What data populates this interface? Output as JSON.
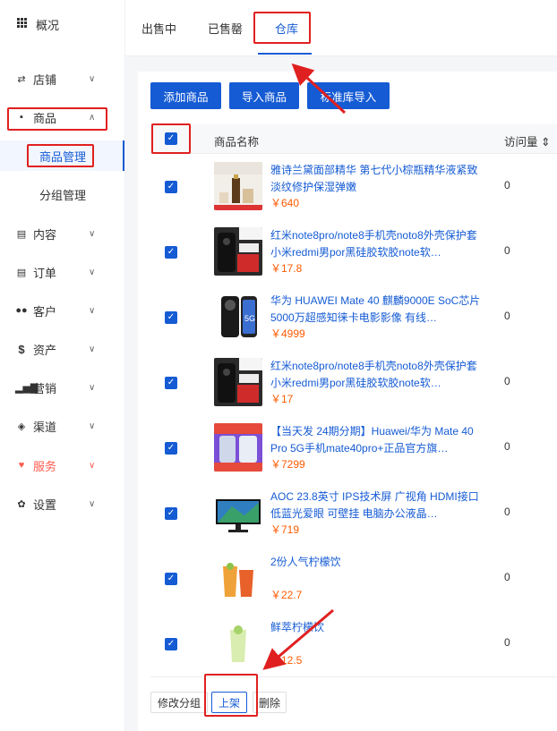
{
  "sidebar": {
    "items": [
      {
        "label": "概况",
        "icon": "grid-icon"
      },
      {
        "label": "店铺",
        "icon": "store-icon"
      },
      {
        "label": "商品",
        "icon": "goods-icon"
      },
      {
        "label": "商品管理"
      },
      {
        "label": "分组管理"
      },
      {
        "label": "内容",
        "icon": "content-icon"
      },
      {
        "label": "订单",
        "icon": "order-icon"
      },
      {
        "label": "客户",
        "icon": "customer-icon"
      },
      {
        "label": "资产",
        "icon": "asset-icon"
      },
      {
        "label": "营销",
        "icon": "marketing-icon"
      },
      {
        "label": "渠道",
        "icon": "channel-icon"
      },
      {
        "label": "服务",
        "icon": "heart-icon"
      },
      {
        "label": "设置",
        "icon": "gear-icon"
      }
    ]
  },
  "tabs": [
    {
      "label": "出售中"
    },
    {
      "label": "已售罄"
    },
    {
      "label": "仓库",
      "active": true
    }
  ],
  "toolbar": {
    "add_label": "添加商品",
    "import_label": "导入商品",
    "std_import_label": "标准库导入"
  },
  "table": {
    "col_name": "商品名称",
    "col_visits": "访问量 ⇕",
    "rows": [
      {
        "title": "雅诗兰黛面部精华 第七代小棕瓶精华液紧致淡纹修护保湿弹嫩",
        "price": "￥640",
        "visits": "0"
      },
      {
        "title": "红米note8pro/note8手机壳noto8外壳保护套小米redmi男por黑硅胶软胶note软…",
        "price": "￥17.8",
        "visits": "0"
      },
      {
        "title": "华为 HUAWEI Mate 40 麒麟9000E SoC芯片 5000万超感知徕卡电影影像 有线…",
        "price": "￥4999",
        "visits": "0"
      },
      {
        "title": "红米note8pro/note8手机壳noto8外壳保护套小米redmi男por黑硅胶软胶note软…",
        "price": "￥17",
        "visits": "0"
      },
      {
        "title": "【当天发 24期分期】Huawei/华为 Mate 40 Pro 5G手机mate40pro+正品官方旗…",
        "price": "￥7299",
        "visits": "0"
      },
      {
        "title": "AOC 23.8英寸 IPS技术屏 广视角 HDMI接口 低蓝光爱眼 可壁挂 电脑办公液晶…",
        "price": "￥719",
        "visits": "0"
      },
      {
        "title": "2份人气柠檬饮",
        "price": "￥22.7",
        "visits": "0"
      },
      {
        "title": "鲜萃柠檬饮",
        "price": "￥12.5",
        "visits": "0"
      }
    ]
  },
  "bulk": {
    "group_label": "修改分组",
    "shelf_label": "上架",
    "delete_label": "删除"
  },
  "colors": {
    "accent": "#155bd4",
    "price": "#ff5a00",
    "annotation": "#e02020"
  }
}
